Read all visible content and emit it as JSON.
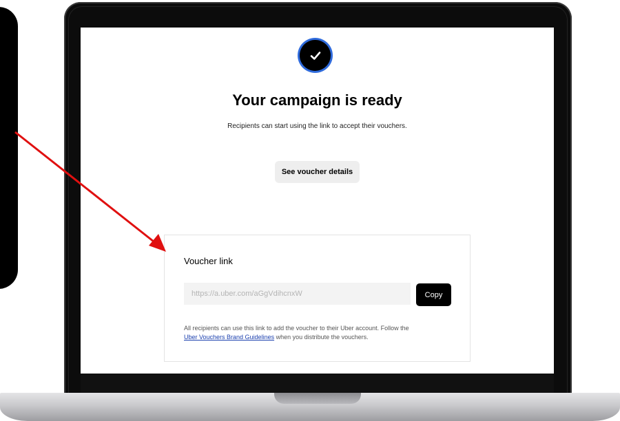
{
  "screen": {
    "title": "Your campaign is ready",
    "subtitle": "Recipients can start using the link to accept their vouchers.",
    "details_button": "See voucher details",
    "voucher_card": {
      "heading": "Voucher link",
      "link_value": "https://a.uber.com/aGgVdihcnxW",
      "copy_button": "Copy",
      "note_before": "All recipients can use this link to add the voucher to their Uber account. Follow the",
      "note_link": "Uber Vouchers Brand Guidelines",
      "note_after": " when you distribute the vouchers."
    }
  },
  "icons": {
    "status": "checkmark-icon",
    "annotation": "red-arrow"
  },
  "colors": {
    "badge_ring": "#2f6bdc",
    "primary_button": "#000000",
    "link": "#1a3fae",
    "annotation_arrow": "#e01010"
  }
}
